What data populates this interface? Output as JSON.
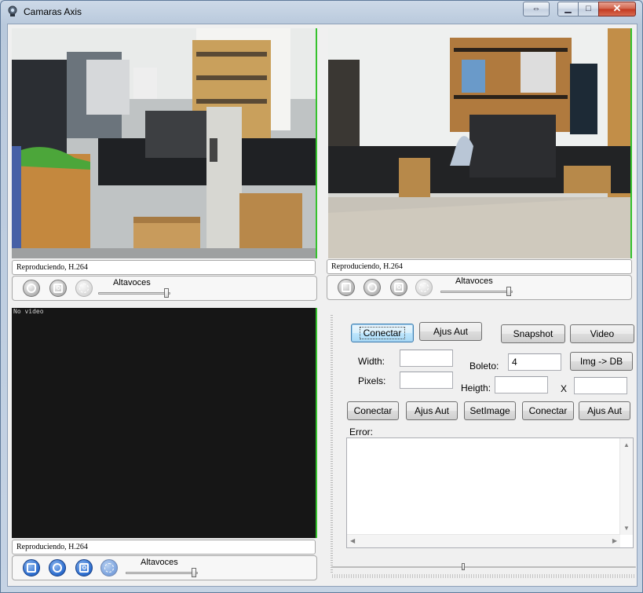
{
  "window": {
    "title": "Camaras Axis",
    "controls": {
      "back_icon": "arrows-icon",
      "minimize": "▁",
      "maximize": "□",
      "close": "✕"
    }
  },
  "cameras": [
    {
      "status": "Reproduciendo, H.264",
      "volume_label": "Altavoces",
      "volume_level": 0.95
    },
    {
      "status": "Reproduciendo, H.264",
      "volume_label": "Altavoces",
      "volume_level": 0.95
    },
    {
      "status": "Reproduciendo, H.264",
      "volume_label": "Altavoces",
      "volume_level": 0.95,
      "overlay": "No video"
    }
  ],
  "panel": {
    "top_buttons": {
      "conectar": "Conectar",
      "ajus_aut": "Ajus Aut",
      "snapshot": "Snapshot",
      "video": "Video"
    },
    "width_label": "Width:",
    "width_value": "",
    "pixels_label": "Pixels:",
    "pixels_value": "",
    "boleto_label": "Boleto:",
    "boleto_value": "4",
    "img_db": "Img -> DB",
    "heigth_label": "Heigth:",
    "heigth_value": "",
    "x_label": "X",
    "x_value": "",
    "row_buttons": [
      "Conectar",
      "Ajus Aut",
      "SetImage",
      "Conectar",
      "Ajus Aut"
    ],
    "error_label": "Error:",
    "error_text": ""
  },
  "colors": {
    "accent_blue": "#2e6fd0",
    "video_bg": "#161616",
    "green_edge": "#35c22d"
  }
}
